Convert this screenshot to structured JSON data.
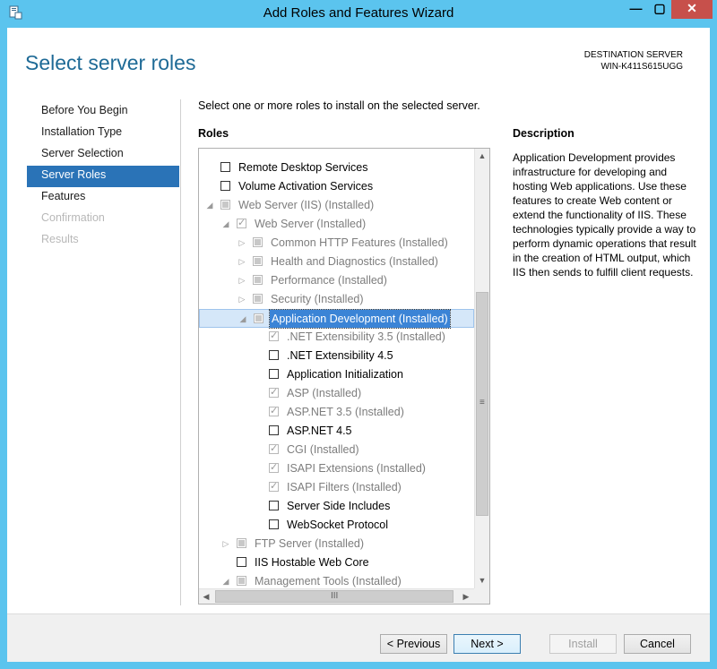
{
  "window": {
    "title": "Add Roles and Features Wizard",
    "minimize_glyph": "—",
    "maximize_glyph": "▢",
    "close_glyph": "✕",
    "accent_color": "#5bc4ee"
  },
  "header": {
    "page_title": "Select server roles",
    "destination_label": "DESTINATION SERVER",
    "destination_server": "WIN-K411S615UGG"
  },
  "nav": {
    "items": [
      {
        "label": "Before You Begin",
        "state": "normal"
      },
      {
        "label": "Installation Type",
        "state": "normal"
      },
      {
        "label": "Server Selection",
        "state": "normal"
      },
      {
        "label": "Server Roles",
        "state": "active"
      },
      {
        "label": "Features",
        "state": "normal"
      },
      {
        "label": "Confirmation",
        "state": "disabled"
      },
      {
        "label": "Results",
        "state": "disabled"
      }
    ]
  },
  "main": {
    "instruction": "Select one or more roles to install on the selected server.",
    "roles_label": "Roles",
    "description_label": "Description",
    "description_text": "Application Development provides infrastructure for developing and hosting Web applications. Use these features to create Web content or extend the functionality of IIS. These technologies typically provide a way to perform dynamic operations that result in the creation of HTML output, which IIS then sends to fulfill client requests."
  },
  "roles_tree": [
    {
      "label": "Remote Desktop Services",
      "level": 0,
      "expander": "none",
      "check": "unchecked",
      "dim": false
    },
    {
      "label": "Volume Activation Services",
      "level": 0,
      "expander": "none",
      "check": "unchecked",
      "dim": false
    },
    {
      "label": "Web Server (IIS) (Installed)",
      "level": 0,
      "expander": "expanded",
      "check": "partial",
      "dim": true
    },
    {
      "label": "Web Server (Installed)",
      "level": 1,
      "expander": "expanded",
      "check": "checked",
      "dim": true
    },
    {
      "label": "Common HTTP Features (Installed)",
      "level": 2,
      "expander": "collapsed",
      "check": "partial",
      "dim": true
    },
    {
      "label": "Health and Diagnostics (Installed)",
      "level": 2,
      "expander": "collapsed",
      "check": "partial",
      "dim": true
    },
    {
      "label": "Performance (Installed)",
      "level": 2,
      "expander": "collapsed",
      "check": "partial",
      "dim": true
    },
    {
      "label": "Security (Installed)",
      "level": 2,
      "expander": "collapsed",
      "check": "partial",
      "dim": true
    },
    {
      "label": "Application Development (Installed)",
      "level": 2,
      "expander": "expanded",
      "check": "partial",
      "dim": true,
      "selected": true
    },
    {
      "label": ".NET Extensibility 3.5 (Installed)",
      "level": 3,
      "expander": "none",
      "check": "checked",
      "dim": true
    },
    {
      "label": ".NET Extensibility 4.5",
      "level": 3,
      "expander": "none",
      "check": "unchecked",
      "dim": false
    },
    {
      "label": "Application Initialization",
      "level": 3,
      "expander": "none",
      "check": "unchecked",
      "dim": false
    },
    {
      "label": "ASP (Installed)",
      "level": 3,
      "expander": "none",
      "check": "checked",
      "dim": true
    },
    {
      "label": "ASP.NET 3.5 (Installed)",
      "level": 3,
      "expander": "none",
      "check": "checked",
      "dim": true
    },
    {
      "label": "ASP.NET 4.5",
      "level": 3,
      "expander": "none",
      "check": "unchecked",
      "dim": false
    },
    {
      "label": "CGI (Installed)",
      "level": 3,
      "expander": "none",
      "check": "checked",
      "dim": true
    },
    {
      "label": "ISAPI Extensions (Installed)",
      "level": 3,
      "expander": "none",
      "check": "checked",
      "dim": true
    },
    {
      "label": "ISAPI Filters (Installed)",
      "level": 3,
      "expander": "none",
      "check": "checked",
      "dim": true
    },
    {
      "label": "Server Side Includes",
      "level": 3,
      "expander": "none",
      "check": "unchecked",
      "dim": false
    },
    {
      "label": "WebSocket Protocol",
      "level": 3,
      "expander": "none",
      "check": "unchecked",
      "dim": false
    },
    {
      "label": "FTP Server (Installed)",
      "level": 1,
      "expander": "collapsed",
      "check": "partial",
      "dim": true
    },
    {
      "label": "IIS Hostable Web Core",
      "level": 1,
      "expander": "none",
      "check": "unchecked",
      "dim": false
    },
    {
      "label": "Management Tools (Installed)",
      "level": 1,
      "expander": "expanded",
      "check": "partial",
      "dim": true
    }
  ],
  "scrollbar": {
    "up_glyph": "▲",
    "down_glyph": "▼",
    "left_glyph": "◀",
    "right_glyph": "▶",
    "grip_glyph": "≡",
    "hgrip_glyph": "III"
  },
  "footer": {
    "previous_label": "< Previous",
    "next_label": "Next >",
    "install_label": "Install",
    "cancel_label": "Cancel"
  },
  "icons": {
    "app": "server-manager-icon",
    "checkmark": "✓",
    "expanded": "◢",
    "collapsed": "▷"
  }
}
